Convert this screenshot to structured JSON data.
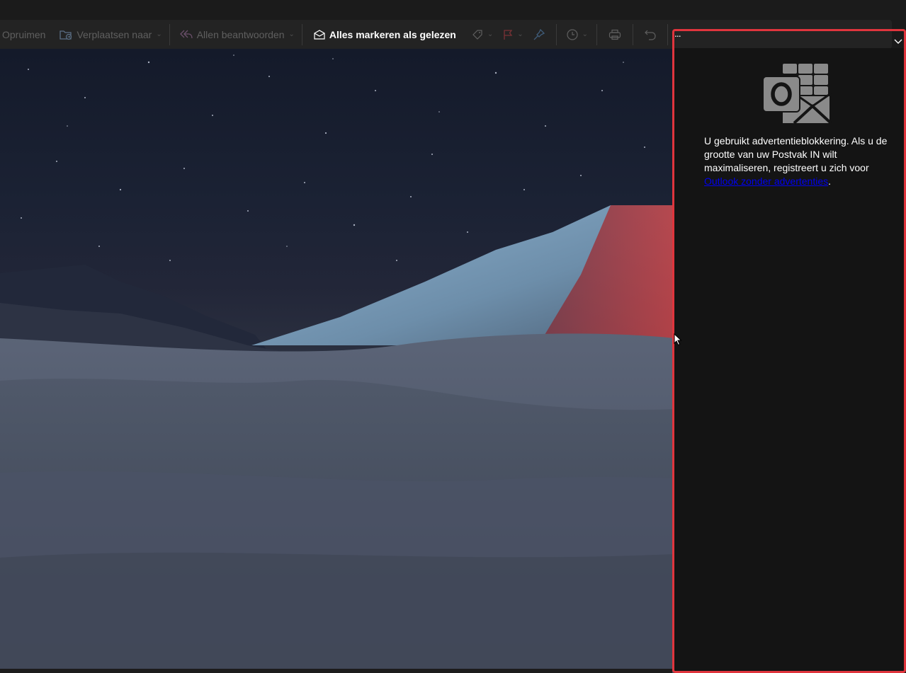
{
  "toolbar": {
    "opruimen_label": "Opruimen",
    "verplaatsen_label": "Verplaatsen naar",
    "allen_beantwoorden_label": "Allen beantwoorden",
    "alles_markeren_label": "Alles markeren als gelezen",
    "more_label": "..."
  },
  "icons": {
    "move_to": "folder-move-icon",
    "reply_all": "reply-all-icon",
    "mark_read": "envelope-open-icon",
    "categorize": "tag-icon",
    "flag": "flag-icon",
    "pin": "pin-icon",
    "snooze": "clock-icon",
    "print": "printer-icon",
    "undo": "undo-icon",
    "collapse": "chevron-down-icon",
    "logo": "outlook-logo-icon"
  },
  "ad_panel": {
    "message": "U gebruikt advertentieblokkering. Als u de grootte van uw Postvak IN wilt maximaliseren, registreert u zich voor",
    "link_text": "Outlook zonder advertenties",
    "trailing": "."
  },
  "colors": {
    "highlight_outline": "#e0353d",
    "link": "#0000ee",
    "panel_background": "#141414",
    "toolbar_background": "#232323"
  }
}
